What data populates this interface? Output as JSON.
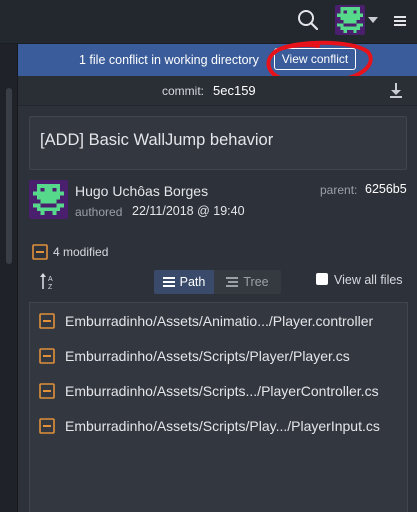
{
  "header": {
    "search_icon": "search-icon",
    "avatar_icon": "user-avatar-icon",
    "caret_icon": "chevron-down-icon",
    "menu_icon": "hamburger-menu-icon"
  },
  "conflict_banner": {
    "message": "1 file conflict in working directory",
    "button_label": "View conflict",
    "background": "#3a5c9a"
  },
  "commit": {
    "label": "commit:",
    "sha": "5ec159",
    "download_icon": "download-icon",
    "message": "[ADD] Basic WallJump behavior",
    "author": "Hugo Uchôas Borges",
    "authored_label": "authored",
    "authored_date": "22/11/2018 @ 19:40",
    "parent_label": "parent:",
    "parent_sha": "6256b5"
  },
  "changes": {
    "modified_count_label": "4 modified",
    "modified_icon": "modified-file-icon",
    "sort_icon": "sort-az-icon",
    "path_label": "Path",
    "tree_label": "Tree",
    "view_all_label": "View all files",
    "view_all_checked": false,
    "files": [
      "Emburradinho/Assets/Animatio.../Player.controller",
      "Emburradinho/Assets/Scripts/Player/Player.cs",
      "Emburradinho/Assets/Scripts.../PlayerController.cs",
      "Emburradinho/Assets/Scripts/Play.../PlayerInput.cs"
    ]
  },
  "colors": {
    "accent_orange": "#e0913a",
    "annotation_red": "#e8121a",
    "panel_bg": "#2d3139"
  }
}
